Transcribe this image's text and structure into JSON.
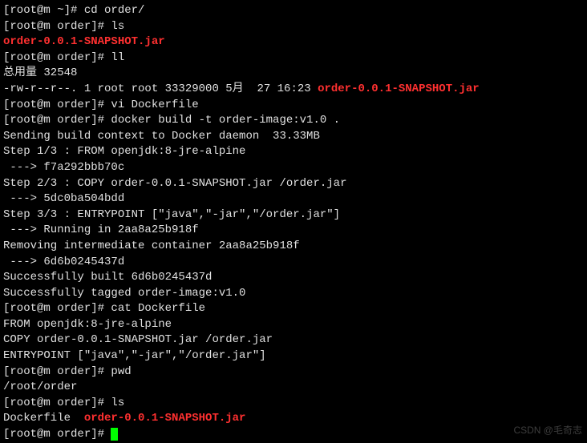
{
  "lines": [
    {
      "segments": [
        {
          "text": "[root@m ~]# cd order/",
          "cls": ""
        }
      ]
    },
    {
      "segments": [
        {
          "text": "[root@m order]# ls",
          "cls": ""
        }
      ]
    },
    {
      "segments": [
        {
          "text": "order-0.0.1-SNAPSHOT.jar",
          "cls": "red"
        }
      ]
    },
    {
      "segments": [
        {
          "text": "[root@m order]# ll",
          "cls": ""
        }
      ]
    },
    {
      "segments": [
        {
          "text": "总用量 32548",
          "cls": ""
        }
      ]
    },
    {
      "segments": [
        {
          "text": "-rw-r--r--. 1 root root 33329000 5月  27 16:23 ",
          "cls": ""
        },
        {
          "text": "order-0.0.1-SNAPSHOT.jar",
          "cls": "red"
        }
      ]
    },
    {
      "segments": [
        {
          "text": "[root@m order]# vi Dockerfile",
          "cls": ""
        }
      ]
    },
    {
      "segments": [
        {
          "text": "[root@m order]# docker build -t order-image:v1.0 .",
          "cls": ""
        }
      ]
    },
    {
      "segments": [
        {
          "text": "Sending build context to Docker daemon  33.33MB",
          "cls": ""
        }
      ]
    },
    {
      "segments": [
        {
          "text": "Step 1/3 : FROM openjdk:8-jre-alpine",
          "cls": ""
        }
      ]
    },
    {
      "segments": [
        {
          "text": " ---> f7a292bbb70c",
          "cls": ""
        }
      ]
    },
    {
      "segments": [
        {
          "text": "Step 2/3 : COPY order-0.0.1-SNAPSHOT.jar /order.jar",
          "cls": ""
        }
      ]
    },
    {
      "segments": [
        {
          "text": " ---> 5dc0ba504bdd",
          "cls": ""
        }
      ]
    },
    {
      "segments": [
        {
          "text": "Step 3/3 : ENTRYPOINT [\"java\",\"-jar\",\"/order.jar\"]",
          "cls": ""
        }
      ]
    },
    {
      "segments": [
        {
          "text": " ---> Running in 2aa8a25b918f",
          "cls": ""
        }
      ]
    },
    {
      "segments": [
        {
          "text": "Removing intermediate container 2aa8a25b918f",
          "cls": ""
        }
      ]
    },
    {
      "segments": [
        {
          "text": " ---> 6d6b0245437d",
          "cls": ""
        }
      ]
    },
    {
      "segments": [
        {
          "text": "Successfully built 6d6b0245437d",
          "cls": ""
        }
      ]
    },
    {
      "segments": [
        {
          "text": "Successfully tagged order-image:v1.0",
          "cls": ""
        }
      ]
    },
    {
      "segments": [
        {
          "text": "[root@m order]# cat Dockerfile",
          "cls": ""
        }
      ]
    },
    {
      "segments": [
        {
          "text": "FROM openjdk:8-jre-alpine",
          "cls": ""
        }
      ]
    },
    {
      "segments": [
        {
          "text": "COPY order-0.0.1-SNAPSHOT.jar /order.jar",
          "cls": ""
        }
      ]
    },
    {
      "segments": [
        {
          "text": "ENTRYPOINT [\"java\",\"-jar\",\"/order.jar\"]",
          "cls": ""
        }
      ]
    },
    {
      "segments": [
        {
          "text": "",
          "cls": ""
        }
      ]
    },
    {
      "segments": [
        {
          "text": "[root@m order]# pwd",
          "cls": ""
        }
      ]
    },
    {
      "segments": [
        {
          "text": "/root/order",
          "cls": ""
        }
      ]
    },
    {
      "segments": [
        {
          "text": "[root@m order]# ls",
          "cls": ""
        }
      ]
    },
    {
      "segments": [
        {
          "text": "Dockerfile  ",
          "cls": ""
        },
        {
          "text": "order-0.0.1-SNAPSHOT.jar",
          "cls": "red"
        }
      ]
    },
    {
      "segments": [
        {
          "text": "[root@m order]# ",
          "cls": ""
        }
      ],
      "cursor": true
    }
  ],
  "watermark": "CSDN @毛奇志"
}
